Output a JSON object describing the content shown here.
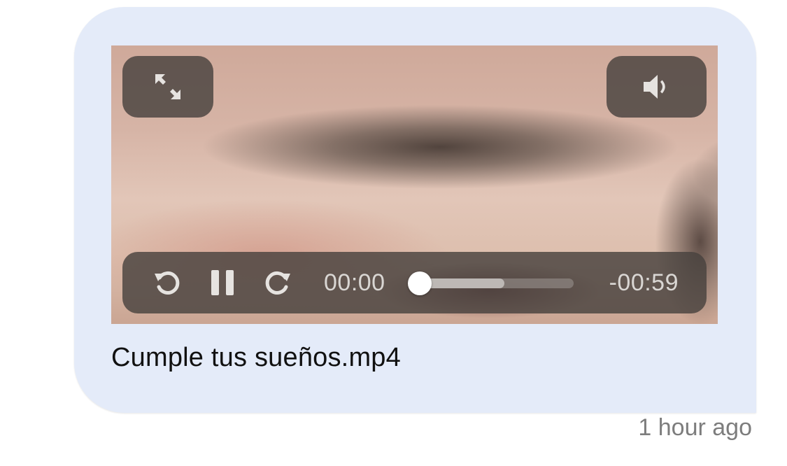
{
  "message": {
    "filename": "Cumple tus sueños.mp4",
    "timestamp": "1 hour ago",
    "bubble_color": "#e4ebf9"
  },
  "player": {
    "current_time": "00:00",
    "remaining_time": "-00:59",
    "playback_state": "playing",
    "progress_fraction": 0.0,
    "buffered_fraction": 0.55,
    "icons": {
      "fullscreen": "expand-arrows-icon",
      "volume": "speaker-icon",
      "rewind": "rewind-icon",
      "pause": "pause-icon",
      "forward": "forward-icon"
    }
  }
}
